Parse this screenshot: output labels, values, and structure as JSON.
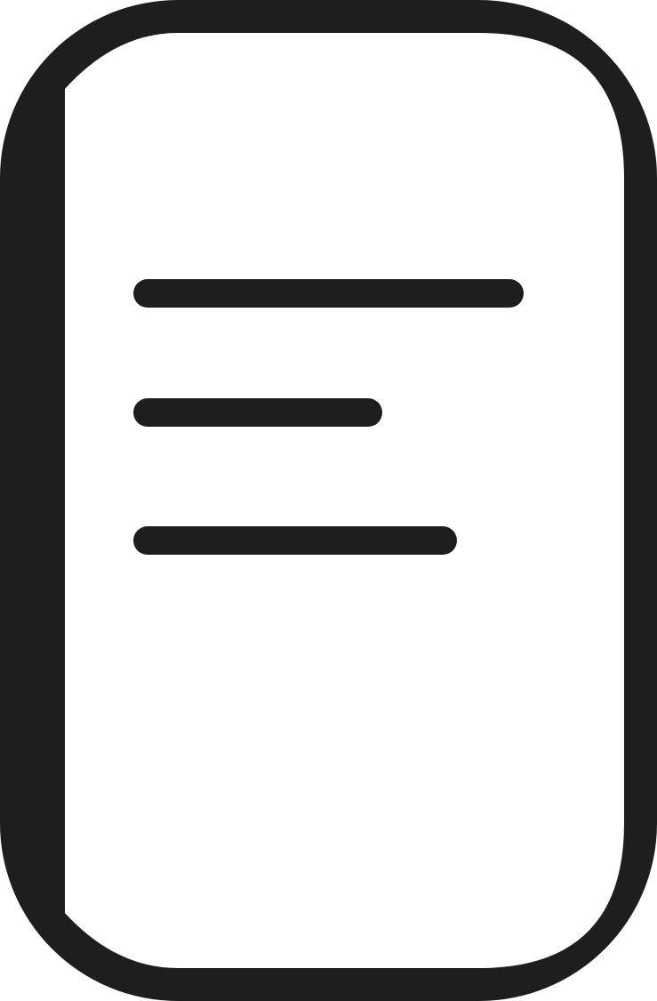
{
  "icon": {
    "name": "document-icon",
    "ink_color": "#1e1e1e",
    "paper_color": "#ffffff",
    "text_lines": [
      {
        "name": "text-line-1"
      },
      {
        "name": "text-line-2"
      },
      {
        "name": "text-line-3"
      }
    ]
  }
}
